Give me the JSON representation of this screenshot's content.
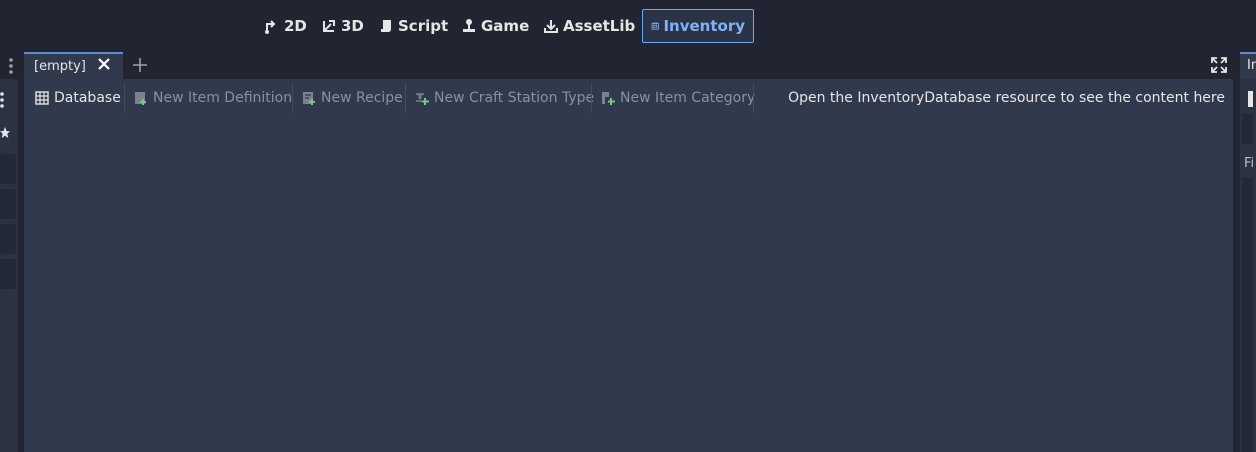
{
  "workspace": {
    "buttons": [
      {
        "label": "2D",
        "icon": "2d-icon"
      },
      {
        "label": "3D",
        "icon": "3d-icon"
      },
      {
        "label": "Script",
        "icon": "script-icon"
      },
      {
        "label": "Game",
        "icon": "game-icon"
      },
      {
        "label": "AssetLib",
        "icon": "assetlib-icon"
      },
      {
        "label": "Inventory",
        "icon": "inventory-icon",
        "active": true
      }
    ]
  },
  "editor": {
    "tab_label": "[empty]",
    "toolbar": {
      "database_label": "Database",
      "new_item_definition_label": "New Item Definition",
      "new_recipe_label": "New Recipe",
      "new_craft_station_type_label": "New Craft Station Type",
      "new_item_category_label": "New Item Category"
    },
    "status_message": "Open the InventoryDatabase resource to see the content here"
  },
  "right_dock": {
    "tab_label": "In",
    "filter_label": "Fi"
  },
  "colors": {
    "background": "#202531",
    "panel": "#313a4c",
    "accent": "#6fa5ec",
    "disabled_text": "#8a909c",
    "icon_green": "#7cc38a"
  }
}
